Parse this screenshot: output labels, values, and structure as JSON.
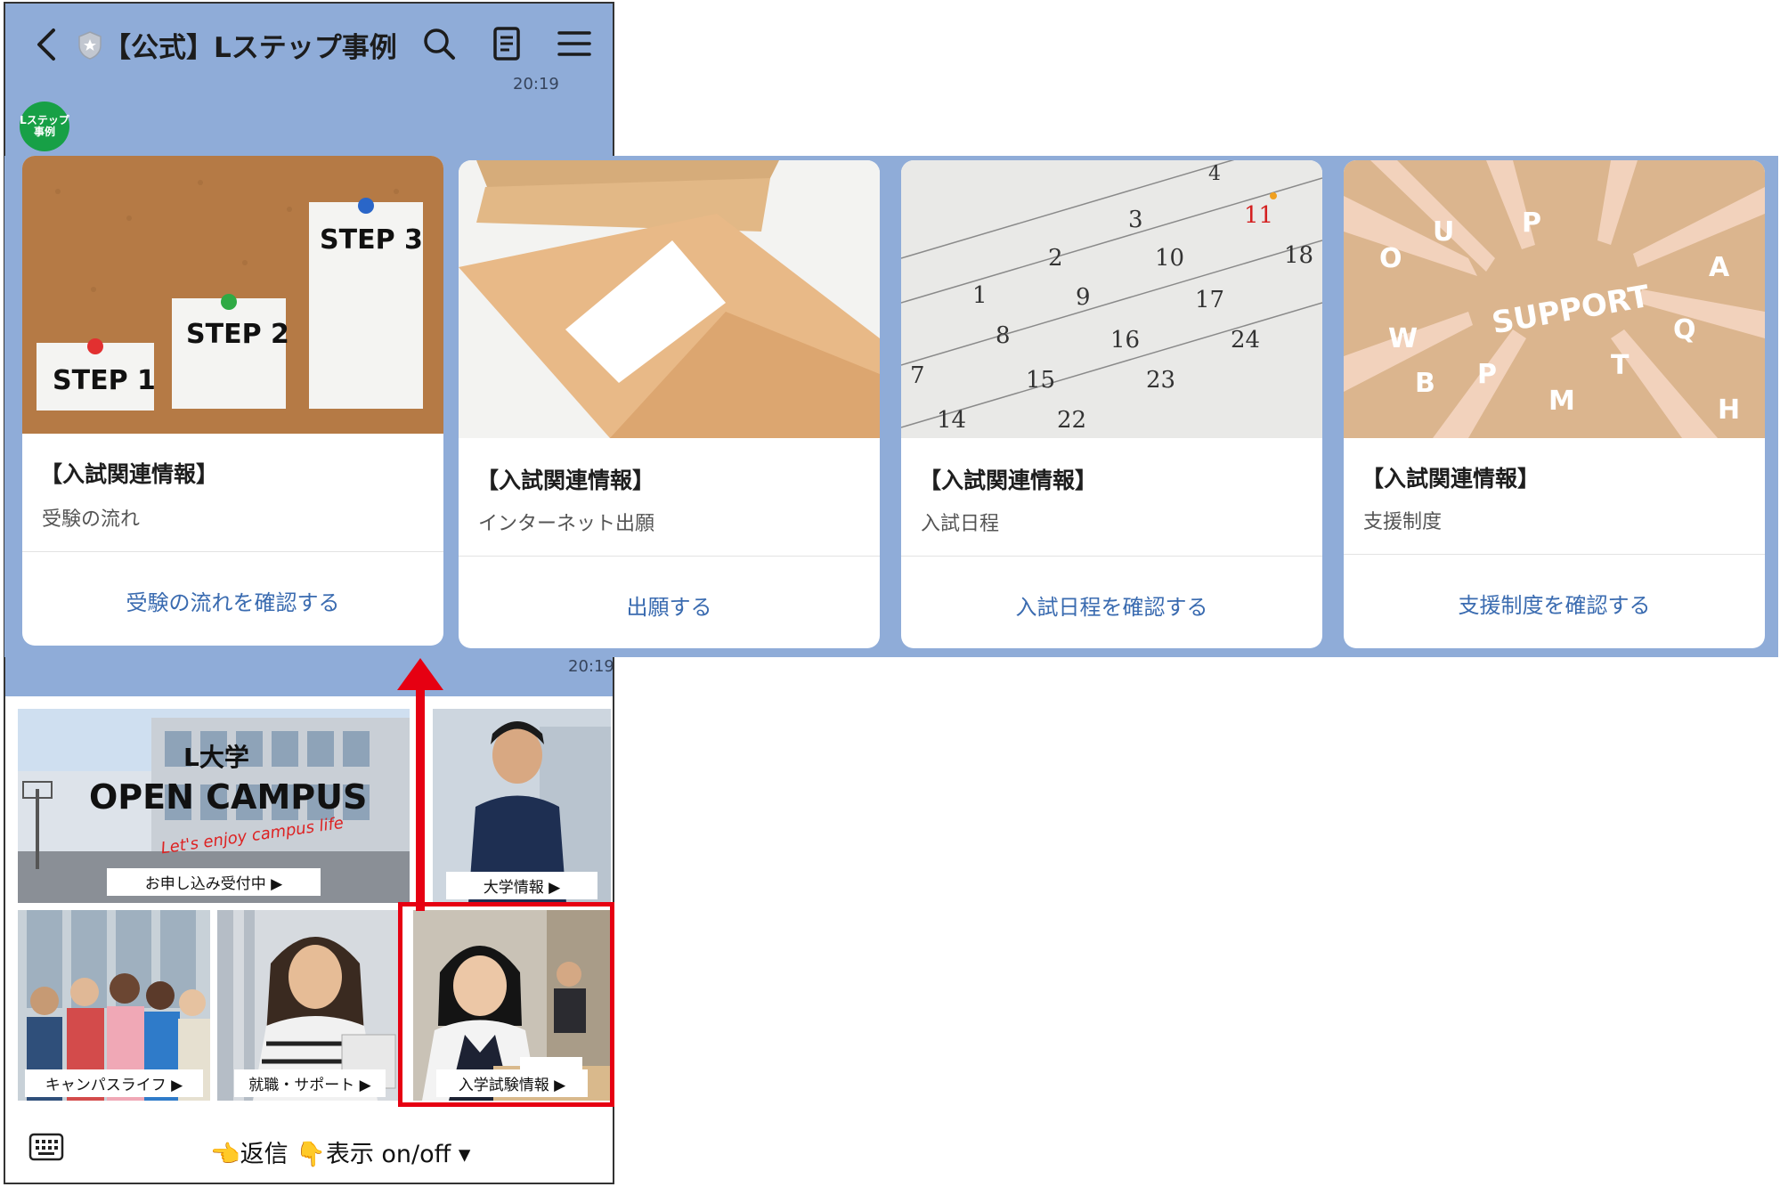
{
  "header": {
    "title": "【公式】Lステップ事例",
    "icons": [
      "back-arrow-icon",
      "shield-star-icon",
      "search-icon",
      "notes-icon",
      "menu-icon"
    ]
  },
  "chat": {
    "time_top": "20:19",
    "time_bottom": "20:19",
    "avatar_text_1": "Lステップ",
    "avatar_text_2": "事例"
  },
  "cards": [
    {
      "title": "【入試関連情報】",
      "subtitle": "受験の流れ",
      "action": "受験の流れを確認する",
      "image": "step-notes-corkboard",
      "image_text": [
        "STEP 1",
        "STEP 2",
        "STEP 3"
      ]
    },
    {
      "title": "【入試関連情報】",
      "subtitle": "インターネット出願",
      "action": "出願する",
      "image": "envelopes"
    },
    {
      "title": "【入試関連情報】",
      "subtitle": "入試日程",
      "action": "入試日程を確認する",
      "image": "calendar",
      "image_text": [
        "1",
        "2",
        "3",
        "4",
        "7",
        "8",
        "9",
        "10",
        "11",
        "14",
        "15",
        "16",
        "17",
        "18",
        "22",
        "23",
        "24"
      ]
    },
    {
      "title": "【入試関連情報】",
      "subtitle": "支援制度",
      "action": "支援制度を確認する",
      "image": "support-letters",
      "image_text": "SUPPORT"
    }
  ],
  "rich_menu": {
    "open_campus": {
      "title_1": "L大学",
      "title_2": "OPEN CAMPUS",
      "tagline": "Let's enjoy campus life",
      "label": "お申し込み受付中 ▶"
    },
    "tiles": [
      {
        "label": "大学情報 ▶"
      },
      {
        "label": "キャンパスライフ ▶"
      },
      {
        "label": "就職・サポート ▶"
      },
      {
        "label": "入学試験情報 ▶"
      }
    ]
  },
  "bottom_bar": {
    "text": "👈返信 👇表示 on/off ▾"
  },
  "colors": {
    "chat_bg": "#8facd8",
    "accent": "#3a6bb0",
    "highlight": "#e60012",
    "line_green": "#17a046"
  }
}
